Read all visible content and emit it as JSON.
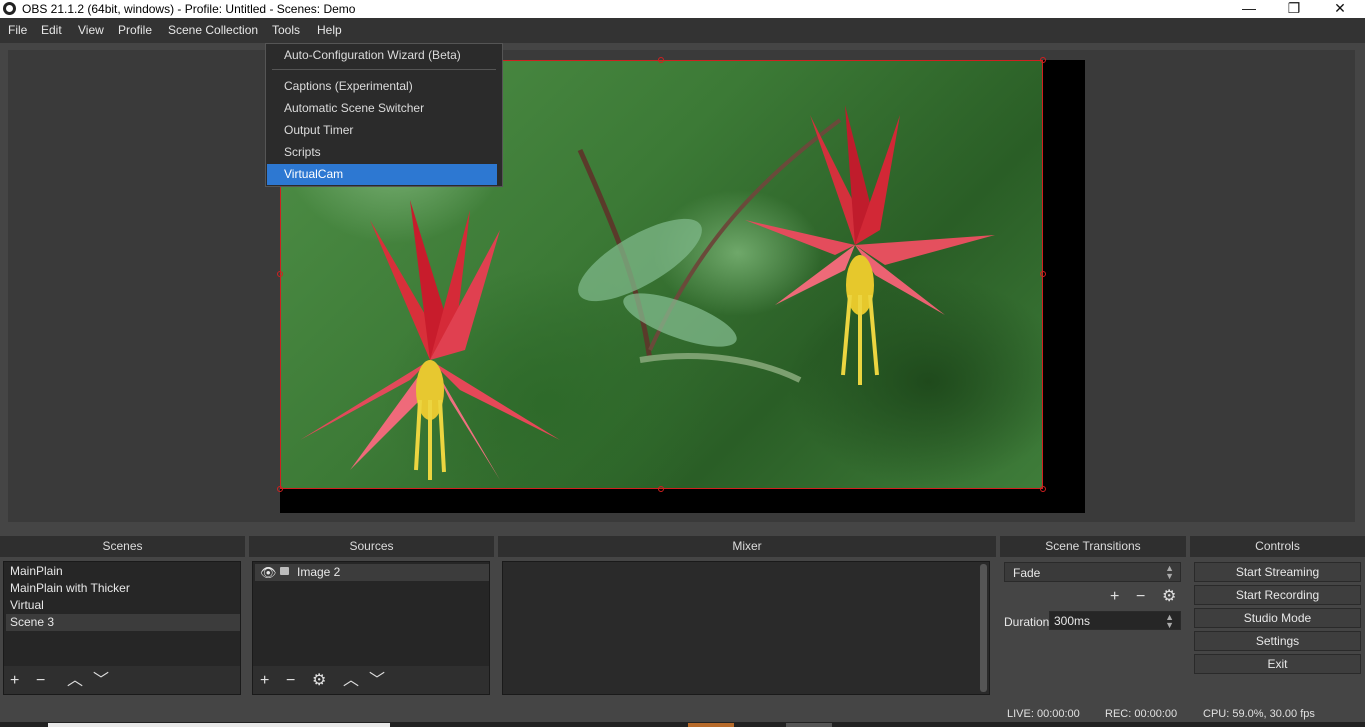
{
  "window": {
    "title": "OBS 21.1.2 (64bit, windows) - Profile: Untitled - Scenes: Demo",
    "minimize_glyph": "—",
    "restore_glyph": "❐",
    "close_glyph": "✕"
  },
  "menubar": {
    "items": [
      "File",
      "Edit",
      "View",
      "Profile",
      "Scene Collection",
      "Tools",
      "Help"
    ]
  },
  "tools_menu": {
    "items": [
      "Auto-Configuration Wizard (Beta)",
      "Captions (Experimental)",
      "Automatic Scene Switcher",
      "Output Timer",
      "Scripts",
      "VirtualCam"
    ],
    "highlighted": "VirtualCam"
  },
  "docks": {
    "scenes": {
      "title": "Scenes",
      "items": [
        "MainPlain",
        "MainPlain with Thicker",
        "Virtual",
        "Scene 3"
      ],
      "selected": "Scene 3"
    },
    "sources": {
      "title": "Sources",
      "items": [
        "Image 2"
      ]
    },
    "mixer": {
      "title": "Mixer"
    },
    "transitions": {
      "title": "Scene Transitions",
      "selected": "Fade",
      "duration_label": "Duration",
      "duration_value": "300ms"
    },
    "controls": {
      "title": "Controls",
      "buttons": [
        "Start Streaming",
        "Start Recording",
        "Studio Mode",
        "Settings",
        "Exit"
      ]
    }
  },
  "toolbar_glyphs": {
    "add": "+",
    "remove": "−",
    "gear": "⚙",
    "up": "︿",
    "down": "﹀"
  },
  "status": {
    "live": "LIVE: 00:00:00",
    "rec": "REC: 00:00:00",
    "cpu": "CPU: 59.0%, 30.00 fps"
  }
}
